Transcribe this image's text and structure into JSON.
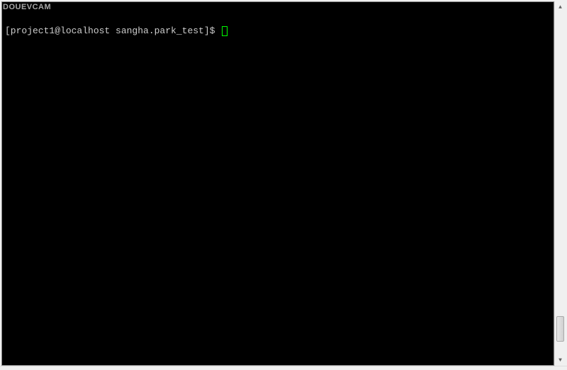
{
  "watermark": "DOUEVCAM",
  "terminal": {
    "prompt": "[project1@localhost sangha.park_test]$ "
  },
  "scrollbar": {
    "arrow_up": "▲",
    "arrow_down": "▼"
  }
}
